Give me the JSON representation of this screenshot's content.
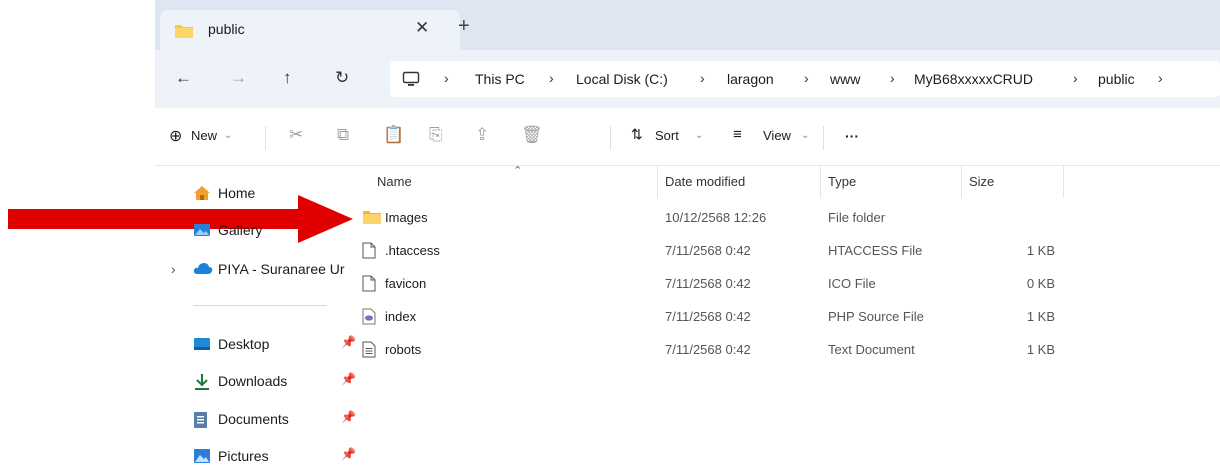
{
  "tab": {
    "title": "public",
    "close_icon": "close-icon",
    "new_tab_icon": "plus-icon"
  },
  "nav": {
    "back_icon": "arrow-left-icon",
    "forward_icon": "arrow-right-icon",
    "up_icon": "arrow-up-icon",
    "refresh_icon": "refresh-icon"
  },
  "breadcrumb": [
    "This PC",
    "Local Disk (C:)",
    "laragon",
    "www",
    "MyB68xxxxxCRUD",
    "public"
  ],
  "toolbar": {
    "new_label": "New",
    "sort_label": "Sort",
    "view_label": "View",
    "more_label": "···"
  },
  "sidebar": {
    "home": "Home",
    "gallery": "Gallery",
    "onedrive": "PIYA - Suranaree Ur",
    "quick_access": [
      "Desktop",
      "Downloads",
      "Documents",
      "Pictures"
    ]
  },
  "columns": {
    "name": "Name",
    "date": "Date modified",
    "type": "Type",
    "size": "Size"
  },
  "files": [
    {
      "name": "Images",
      "date": "10/12/2568 12:26",
      "type": "File folder",
      "size": "",
      "icon": "folder-icon"
    },
    {
      "name": ".htaccess",
      "date": "7/11/2568 0:42",
      "type": "HTACCESS File",
      "size": "1 KB",
      "icon": "file-icon"
    },
    {
      "name": "favicon",
      "date": "7/11/2568 0:42",
      "type": "ICO File",
      "size": "0 KB",
      "icon": "file-icon"
    },
    {
      "name": "index",
      "date": "7/11/2568 0:42",
      "type": "PHP Source File",
      "size": "1 KB",
      "icon": "php-file-icon"
    },
    {
      "name": "robots",
      "date": "7/11/2568 0:42",
      "type": "Text Document",
      "size": "1 KB",
      "icon": "text-file-icon"
    }
  ],
  "colors": {
    "accent": "#0067c0",
    "folder": "#f8c44f",
    "annotation_arrow": "#e00000"
  }
}
